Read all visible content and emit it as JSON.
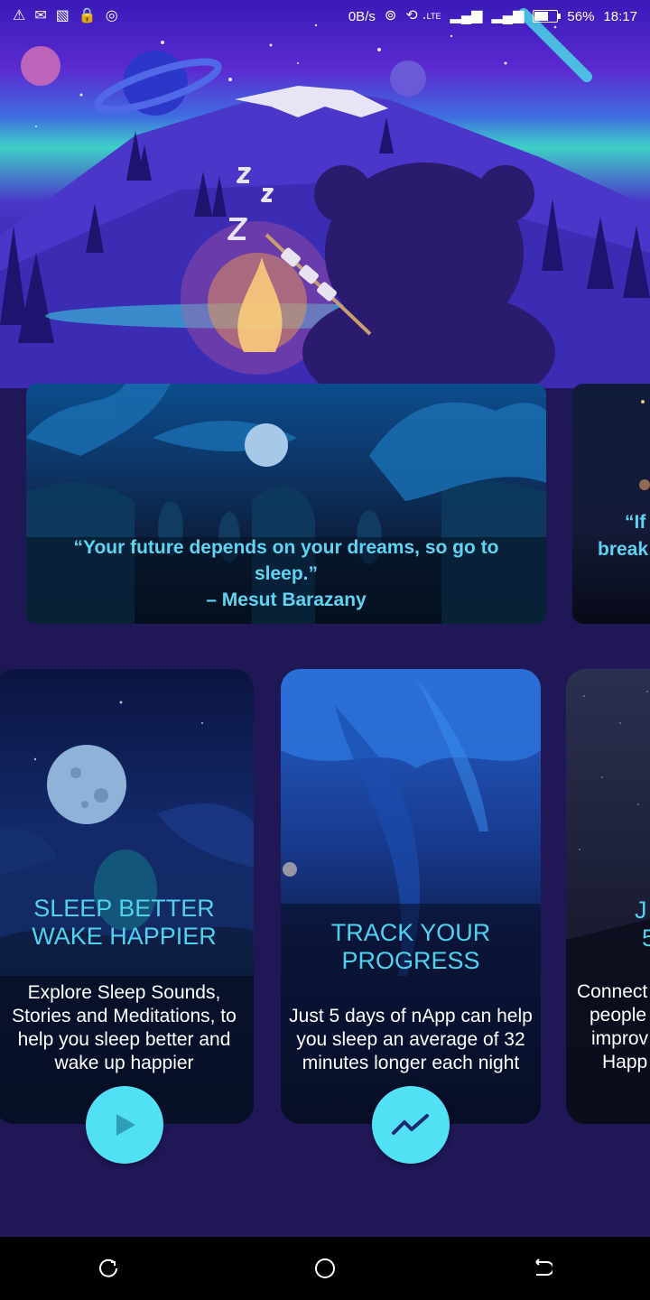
{
  "status_bar": {
    "left_icons": [
      "warning-icon",
      "gmail-icon",
      "cast-icon",
      "lock-icon",
      "record-icon"
    ],
    "network_speed": "0B/s",
    "lte_label": "LTE",
    "battery_percent": "56%",
    "battery_level": 0.56,
    "time": "18:17"
  },
  "quotes": [
    {
      "text": "“Your future depends on your dreams, so go to sleep.”",
      "author": "– Mesut Barazany"
    },
    {
      "text_partial_line1": "“If",
      "text_partial_line2": "break"
    }
  ],
  "features": [
    {
      "title_line1": "SLEEP BETTER",
      "title_line2": "WAKE HAPPIER",
      "description": "Explore Sleep Sounds, Stories and Meditations, to help you sleep better and wake up happier",
      "button_icon": "play-icon"
    },
    {
      "title_line1": "TRACK YOUR",
      "title_line2": "PROGRESS",
      "description": "Just 5 days of nApp can help you sleep an average of 32 minutes longer each night",
      "button_icon": "trend-icon"
    },
    {
      "title_line1": "J",
      "title_line2": "5",
      "desc_line1": "Connect",
      "desc_line2": "people",
      "desc_line3": "improv",
      "desc_line4": "Happ"
    }
  ],
  "colors": {
    "accent": "#52e0f4",
    "title": "#4fd2ee",
    "quote": "#5fd4f0",
    "background": "#1f1756"
  },
  "nav_icons": [
    "recent-apps-icon",
    "home-icon",
    "back-icon"
  ]
}
